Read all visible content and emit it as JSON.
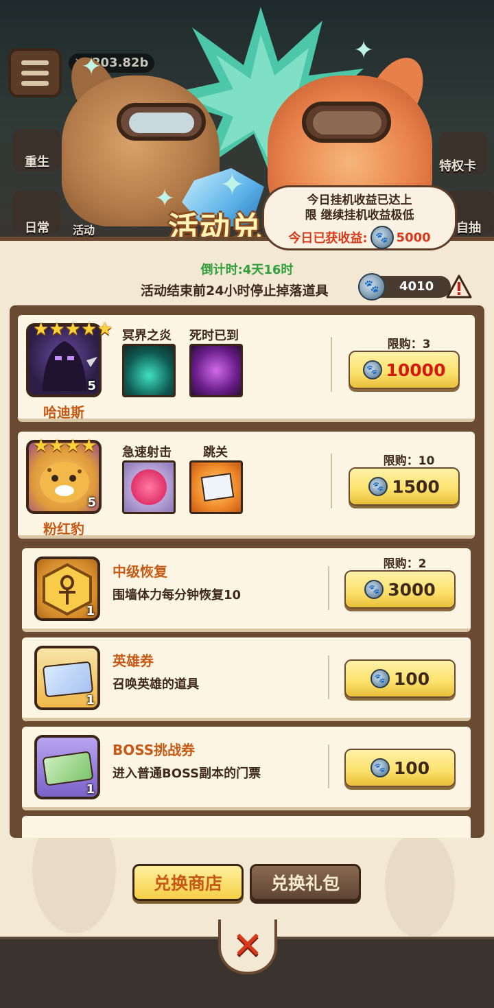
{
  "top": {
    "power_value": "203.82b",
    "side_left": [
      "重生",
      "日常",
      "活动"
    ],
    "side_right": [
      "特权卡",
      "自抽"
    ],
    "event_title": "活动兑"
  },
  "notice": {
    "line1": "今日挂机收益已达上",
    "line2": "限 继续挂机收益极低",
    "earned_label": "今日已获收益:",
    "earned_value": "5000"
  },
  "header": {
    "countdown": "倒计时:4天16时",
    "stop_note": "活动结束前24小时停止掉落道具",
    "balance": "4010"
  },
  "heroes": [
    {
      "name": "哈迪斯",
      "stars": 5,
      "level": "5",
      "skills": [
        "冥界之炎",
        "死时已到"
      ],
      "limit": "限购：3",
      "price": "10000",
      "price_color": "#d41a10"
    },
    {
      "name": "粉红豹",
      "stars": 4,
      "level": "5",
      "skills": [
        "急速射击",
        "跳关"
      ],
      "limit": "限购：10",
      "price": "1500",
      "price_color": "#3e2a1c"
    }
  ],
  "items": [
    {
      "title": "中级恢复",
      "desc": "围墙体力每分钟恢复10",
      "qty": "1",
      "limit": "限购：2",
      "price": "3000"
    },
    {
      "title": "英雄券",
      "desc": "召唤英雄的道具",
      "qty": "1",
      "limit": "",
      "price": "100"
    },
    {
      "title": "BOSS挑战券",
      "desc": "进入普通BOSS副本的门票",
      "qty": "1",
      "limit": "",
      "price": "100"
    }
  ],
  "footer": {
    "shop_label": "兑换商店",
    "gift_label": "兑换礼包"
  },
  "icons": {
    "coin": "paw-coin-icon",
    "close": "close-icon",
    "warning": "warning-icon"
  },
  "colors": {
    "accent_orange": "#c45a16",
    "price_red": "#d41a10",
    "countdown_green": "#2fa03a",
    "panel": "#f3e8d4",
    "frame": "#6b4a32"
  }
}
